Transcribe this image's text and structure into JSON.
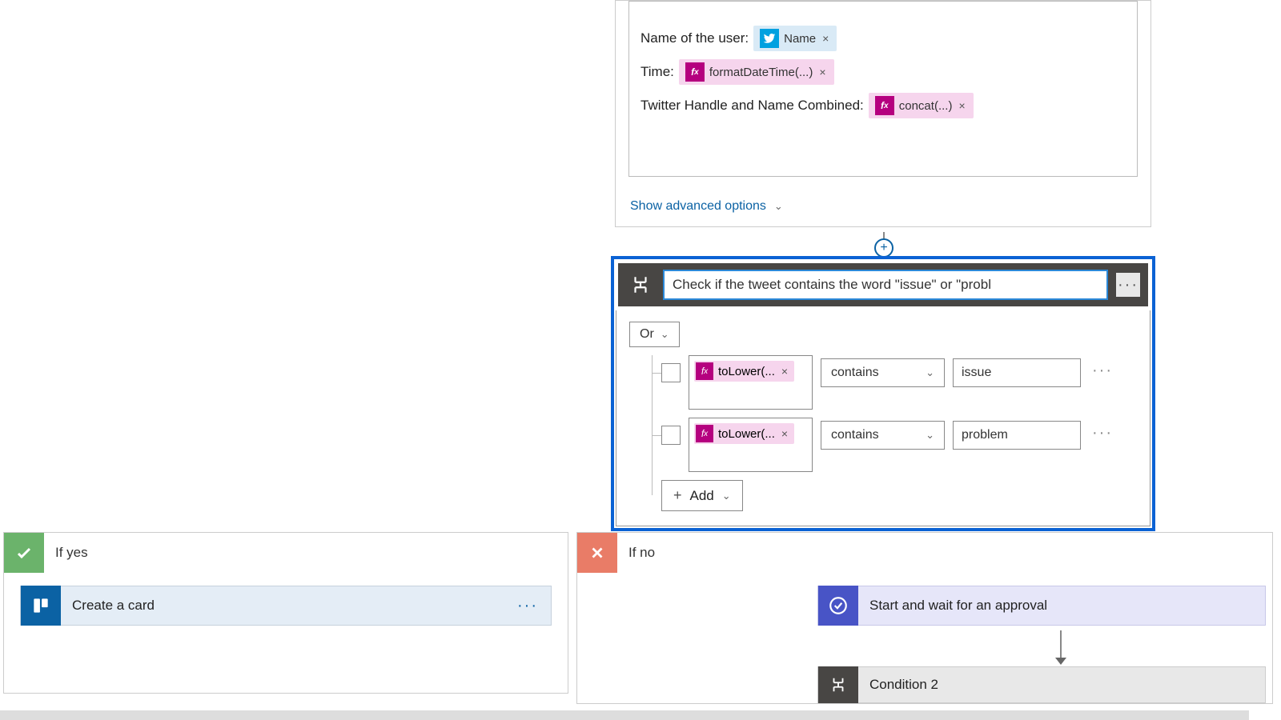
{
  "top_card": {
    "fields": [
      {
        "label": "Name of the user:",
        "token": {
          "type": "twitter",
          "text": "Name"
        }
      },
      {
        "label": "Time:",
        "token": {
          "type": "fx",
          "text": "formatDateTime(...)"
        }
      },
      {
        "label": "Twitter Handle and Name Combined:",
        "token": {
          "type": "fx",
          "text": "concat(...)"
        }
      }
    ],
    "show_advanced": "Show advanced options"
  },
  "condition": {
    "title_value": "Check if the tweet contains the word \"issue\" or \"probl",
    "group_op": "Or",
    "rows": [
      {
        "expr": "toLower(...",
        "operator": "contains",
        "value": "issue"
      },
      {
        "expr": "toLower(...",
        "operator": "contains",
        "value": "problem"
      }
    ],
    "add_label": "Add"
  },
  "branches": {
    "yes": {
      "label": "If yes",
      "actions": [
        {
          "kind": "trello",
          "label": "Create a card"
        }
      ]
    },
    "no": {
      "label": "If no",
      "actions": [
        {
          "kind": "approval",
          "label": "Start and wait for an approval"
        },
        {
          "kind": "condition",
          "label": "Condition 2"
        }
      ]
    }
  }
}
